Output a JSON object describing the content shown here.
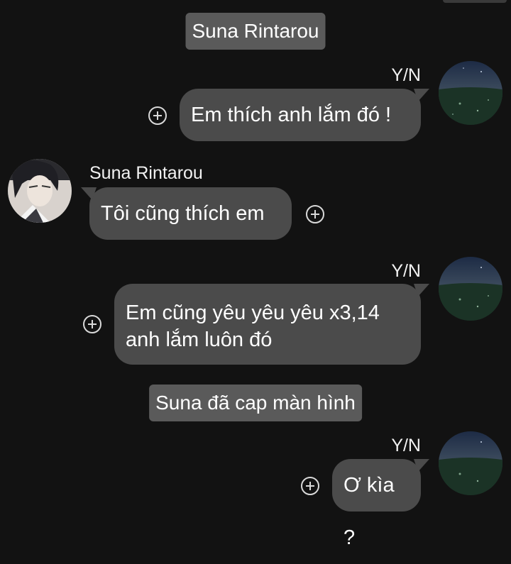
{
  "messages": [
    {
      "type": "system",
      "text": "Suna Rintarou"
    },
    {
      "type": "outgoing",
      "sender": "Y/N",
      "text": "Em thích anh lắm đó !"
    },
    {
      "type": "incoming",
      "sender": "Suna Rintarou",
      "text": "Tôi cũng thích em"
    },
    {
      "type": "outgoing",
      "sender": "Y/N",
      "lines": [
        "Em cũng yêu yêu yêu x3,14",
        "anh lắm luôn đó"
      ]
    },
    {
      "type": "system",
      "text": "Suna đã cap màn hình"
    },
    {
      "type": "outgoing",
      "sender": "Y/N",
      "text": "Ơ kìa ?"
    }
  ],
  "icons": {
    "reaction": "add-reaction-icon",
    "avatar_me": "night-field-avatar",
    "avatar_suna": "anime-boy-avatar"
  },
  "colors": {
    "background": "#121212",
    "bubble": "#4b4b4b",
    "system_note": "#5a5a5a",
    "text": "#ffffff"
  }
}
